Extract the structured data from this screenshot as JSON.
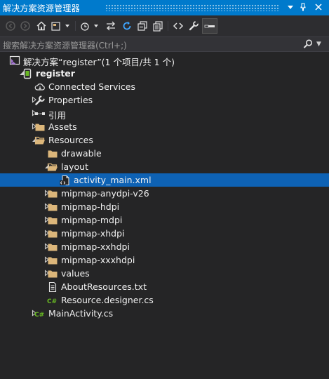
{
  "panel": {
    "title": "解决方案资源管理器",
    "search_placeholder": "搜索解决方案资源管理器(Ctrl+;)"
  },
  "titlebar_buttons": [
    {
      "name": "dropdown-icon"
    },
    {
      "name": "pin-icon"
    },
    {
      "name": "close-icon"
    }
  ],
  "toolbar": [
    {
      "name": "back-icon"
    },
    {
      "name": "forward-icon"
    },
    {
      "name": "home-icon"
    },
    {
      "name": "switch-views-icon"
    },
    {
      "name": "pending-changes-filter-icon"
    },
    {
      "name": "sync-with-active-document-icon"
    },
    {
      "name": "refresh-icon"
    },
    {
      "name": "collapse-all-icon"
    },
    {
      "name": "show-all-files-icon"
    },
    {
      "name": "view-code-icon"
    },
    {
      "name": "properties-icon"
    },
    {
      "name": "preview-selected-items-icon"
    }
  ],
  "tree": [
    {
      "label": "解决方案“register”(1 个项目/共 1 个)",
      "icon": "solution-icon",
      "arrow": "none",
      "level": 0,
      "bold": false
    },
    {
      "label": "register",
      "icon": "android-project-icon",
      "arrow": "expanded",
      "level": 1,
      "bold": true
    },
    {
      "label": "Connected Services",
      "icon": "connected-services-icon",
      "arrow": "none",
      "level": 2,
      "bold": false
    },
    {
      "label": "Properties",
      "icon": "wrench-icon",
      "arrow": "collapsed",
      "level": 2,
      "bold": false
    },
    {
      "label": "引用",
      "icon": "references-icon",
      "arrow": "collapsed",
      "level": 2,
      "bold": false
    },
    {
      "label": "Assets",
      "icon": "folder-icon",
      "arrow": "collapsed",
      "level": 2,
      "bold": false
    },
    {
      "label": "Resources",
      "icon": "folder-open-icon",
      "arrow": "expanded",
      "level": 2,
      "bold": false
    },
    {
      "label": "drawable",
      "icon": "folder-icon",
      "arrow": "none",
      "level": 3,
      "bold": false
    },
    {
      "label": "layout",
      "icon": "folder-open-icon",
      "arrow": "expanded",
      "level": 3,
      "bold": false
    },
    {
      "label": "activity_main.xml",
      "icon": "xml-file-icon",
      "arrow": "none",
      "level": 4,
      "bold": false,
      "selected": true
    },
    {
      "label": "mipmap-anydpi-v26",
      "icon": "folder-icon",
      "arrow": "collapsed",
      "level": 3,
      "bold": false
    },
    {
      "label": "mipmap-hdpi",
      "icon": "folder-icon",
      "arrow": "collapsed",
      "level": 3,
      "bold": false
    },
    {
      "label": "mipmap-mdpi",
      "icon": "folder-icon",
      "arrow": "collapsed",
      "level": 3,
      "bold": false
    },
    {
      "label": "mipmap-xhdpi",
      "icon": "folder-icon",
      "arrow": "collapsed",
      "level": 3,
      "bold": false
    },
    {
      "label": "mipmap-xxhdpi",
      "icon": "folder-icon",
      "arrow": "collapsed",
      "level": 3,
      "bold": false
    },
    {
      "label": "mipmap-xxxhdpi",
      "icon": "folder-icon",
      "arrow": "collapsed",
      "level": 3,
      "bold": false
    },
    {
      "label": "values",
      "icon": "folder-icon",
      "arrow": "collapsed",
      "level": 3,
      "bold": false
    },
    {
      "label": "AboutResources.txt",
      "icon": "text-file-icon",
      "arrow": "none",
      "level": 3,
      "bold": false
    },
    {
      "label": "Resource.designer.cs",
      "icon": "csharp-file-icon",
      "arrow": "none",
      "level": 3,
      "bold": false
    },
    {
      "label": "MainActivity.cs",
      "icon": "csharp-file-icon",
      "arrow": "collapsed",
      "level": 2,
      "bold": false
    }
  ],
  "colors": {
    "accent": "#007acc",
    "background": "#252526",
    "selection": "#0e62b4",
    "folder": "#dcb67a",
    "csharp": "#68b723"
  }
}
